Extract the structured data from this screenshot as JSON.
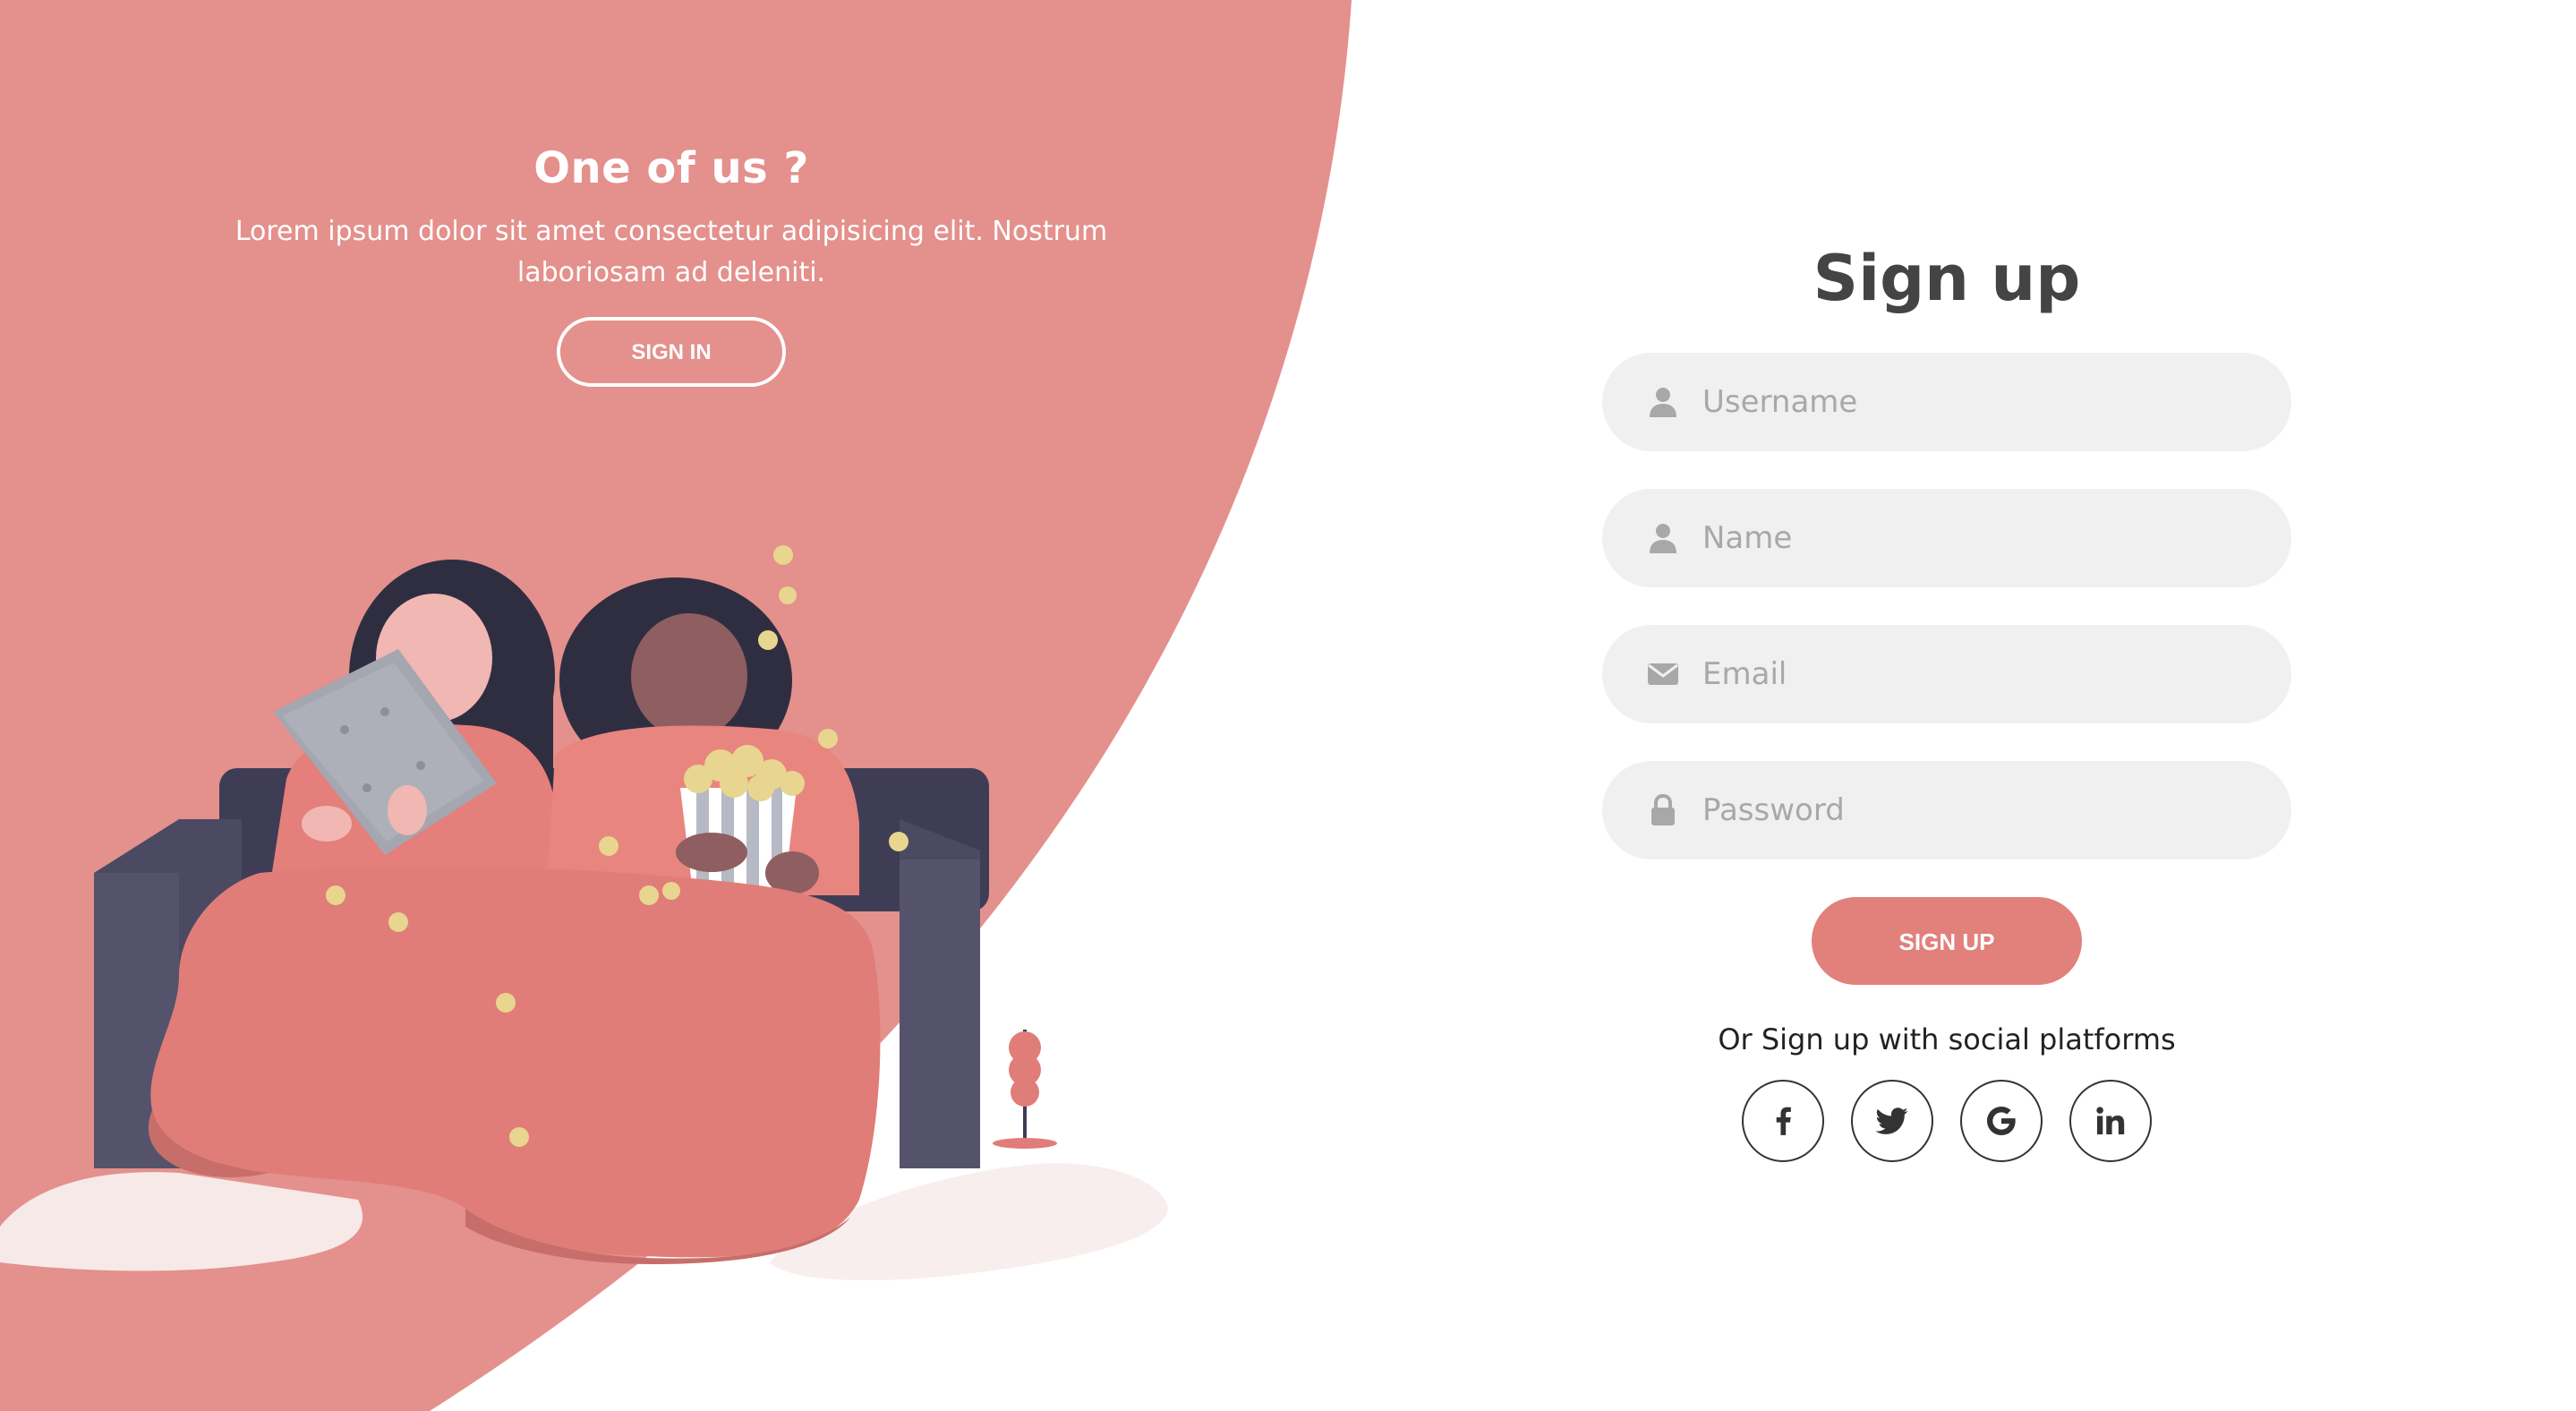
{
  "colors": {
    "accent": "#e2807c",
    "background_panel": "#e4908c",
    "field_background": "#f0f0f0",
    "title_text": "#444444"
  },
  "left_panel": {
    "title": "One of us ?",
    "description": "Lorem ipsum dolor sit amet consectetur adipisicing elit. Nostrum laboriosam ad deleniti.",
    "sign_in_label": "SIGN IN"
  },
  "form": {
    "title": "Sign up",
    "fields": [
      {
        "icon": "user-icon",
        "placeholder": "Username",
        "value": ""
      },
      {
        "icon": "user-icon",
        "placeholder": "Name",
        "value": ""
      },
      {
        "icon": "envelope-icon",
        "placeholder": "Email",
        "value": ""
      },
      {
        "icon": "lock-icon",
        "placeholder": "Password",
        "value": ""
      }
    ],
    "submit_label": "SIGN UP",
    "social_text": "Or Sign up with social platforms",
    "social": [
      {
        "icon": "facebook-icon"
      },
      {
        "icon": "twitter-icon"
      },
      {
        "icon": "google-icon"
      },
      {
        "icon": "linkedin-icon"
      }
    ]
  }
}
